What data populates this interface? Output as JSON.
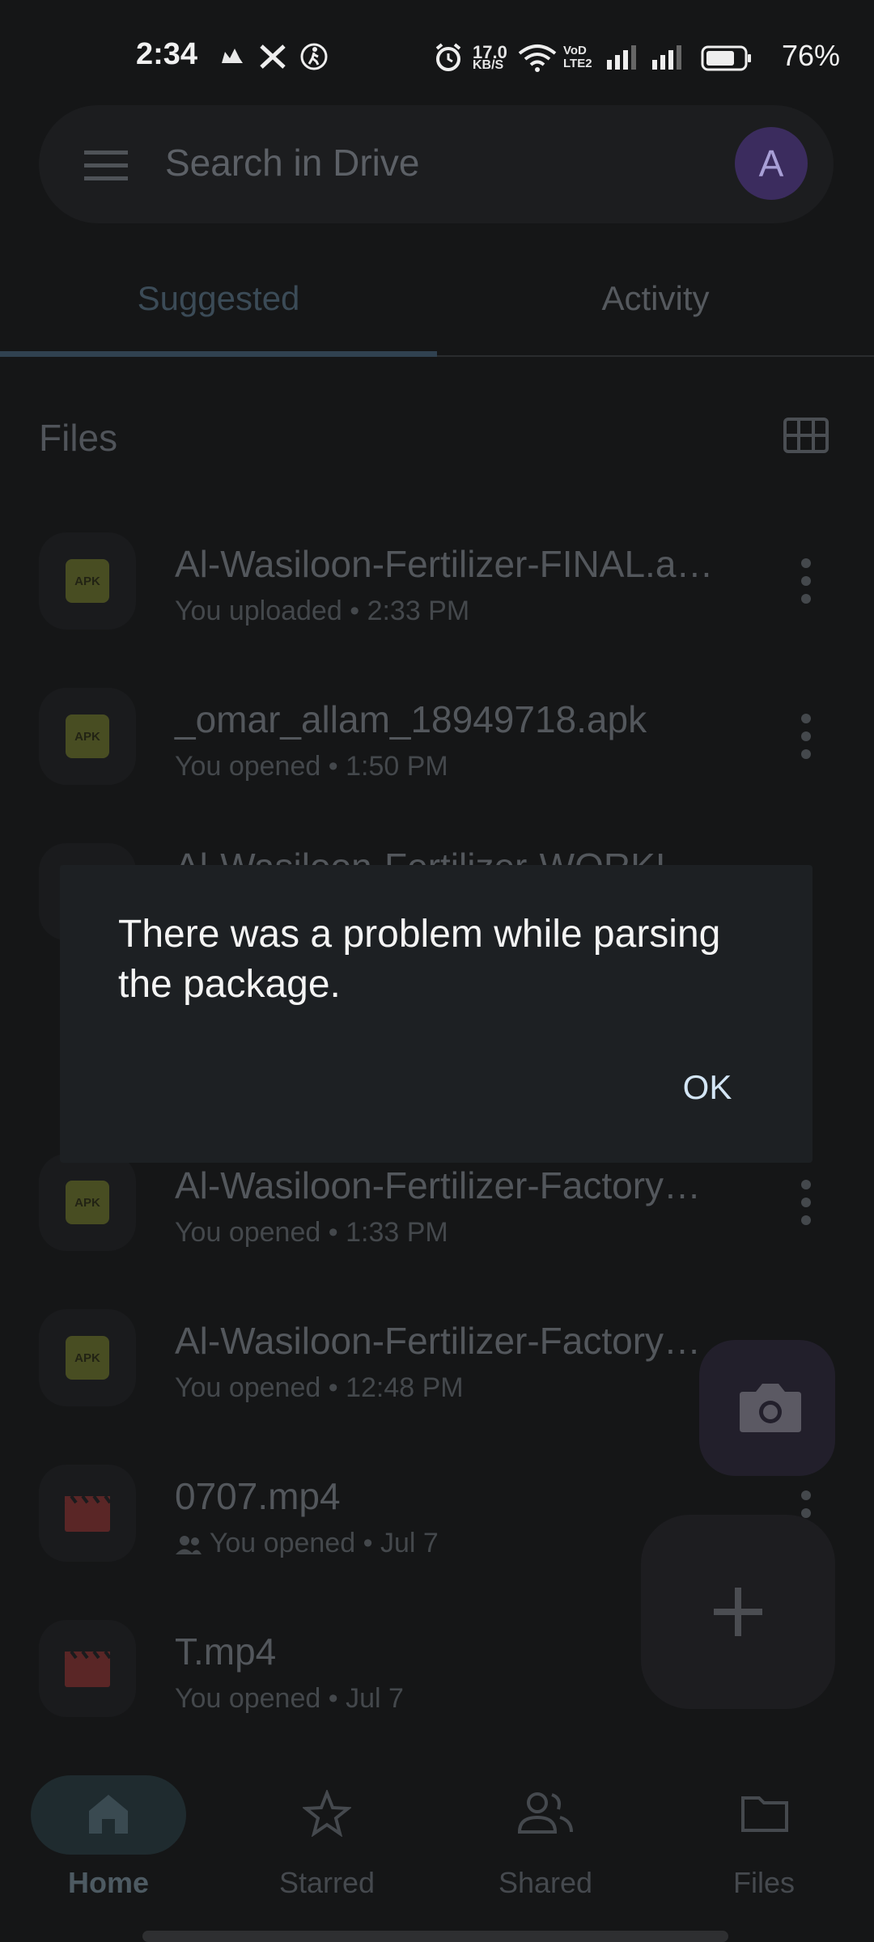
{
  "status_bar": {
    "time": "2:34",
    "net_speed_value": "17.0",
    "net_speed_unit": "KB/S",
    "volte_top": "VoD",
    "volte_bottom": "LTE2",
    "battery": "76%",
    "icons": [
      "notification-icon",
      "x-icon",
      "running-icon",
      "alarm-icon",
      "wifi-icon",
      "signal-icon",
      "signal-icon",
      "battery-icon"
    ]
  },
  "search": {
    "placeholder": "Search in Drive",
    "avatar_letter": "A"
  },
  "tabs": [
    {
      "label": "Suggested",
      "active": true
    },
    {
      "label": "Activity",
      "active": false
    }
  ],
  "files_heading": "Files",
  "files": [
    {
      "name": "Al-Wasiloon-Fertilizer-FINAL.a…",
      "action": "You uploaded",
      "time": "2:33 PM",
      "type": "APK"
    },
    {
      "name": "_omar_allam_18949718.apk",
      "action": "You opened",
      "time": "1:50 PM",
      "type": "APK"
    },
    {
      "name": "Al-Wasiloon-Fertilizer-WORKI…",
      "action": "",
      "time": "",
      "type": "APK"
    },
    {
      "name": "Al-Wasiloon-Fertilizer-Factory…",
      "action": "You opened",
      "time": "1:33 PM",
      "type": "APK"
    },
    {
      "name": "Al-Wasiloon-Fertilizer-Factory…",
      "action": "You opened",
      "time": "12:48 PM",
      "type": "APK"
    },
    {
      "name": "0707.mp4",
      "action": "You opened",
      "time": "Jul 7",
      "type": "video",
      "shared": true
    },
    {
      "name": "T.mp4",
      "action": "You opened",
      "time": "Jul 7",
      "type": "video"
    }
  ],
  "dialog": {
    "message": "There was a problem while parsing the package.",
    "ok_label": "OK"
  },
  "bottom_nav": [
    {
      "label": "Home",
      "icon": "home-icon",
      "active": true
    },
    {
      "label": "Starred",
      "icon": "star-icon",
      "active": false
    },
    {
      "label": "Shared",
      "icon": "shared-icon",
      "active": false
    },
    {
      "label": "Files",
      "icon": "folder-icon",
      "active": false
    }
  ],
  "colors": {
    "background": "#151617",
    "dialog": "#1d2023",
    "apk_badge": "#484d22",
    "video_icon": "#5a2626",
    "accent": "#d3e5f5"
  }
}
